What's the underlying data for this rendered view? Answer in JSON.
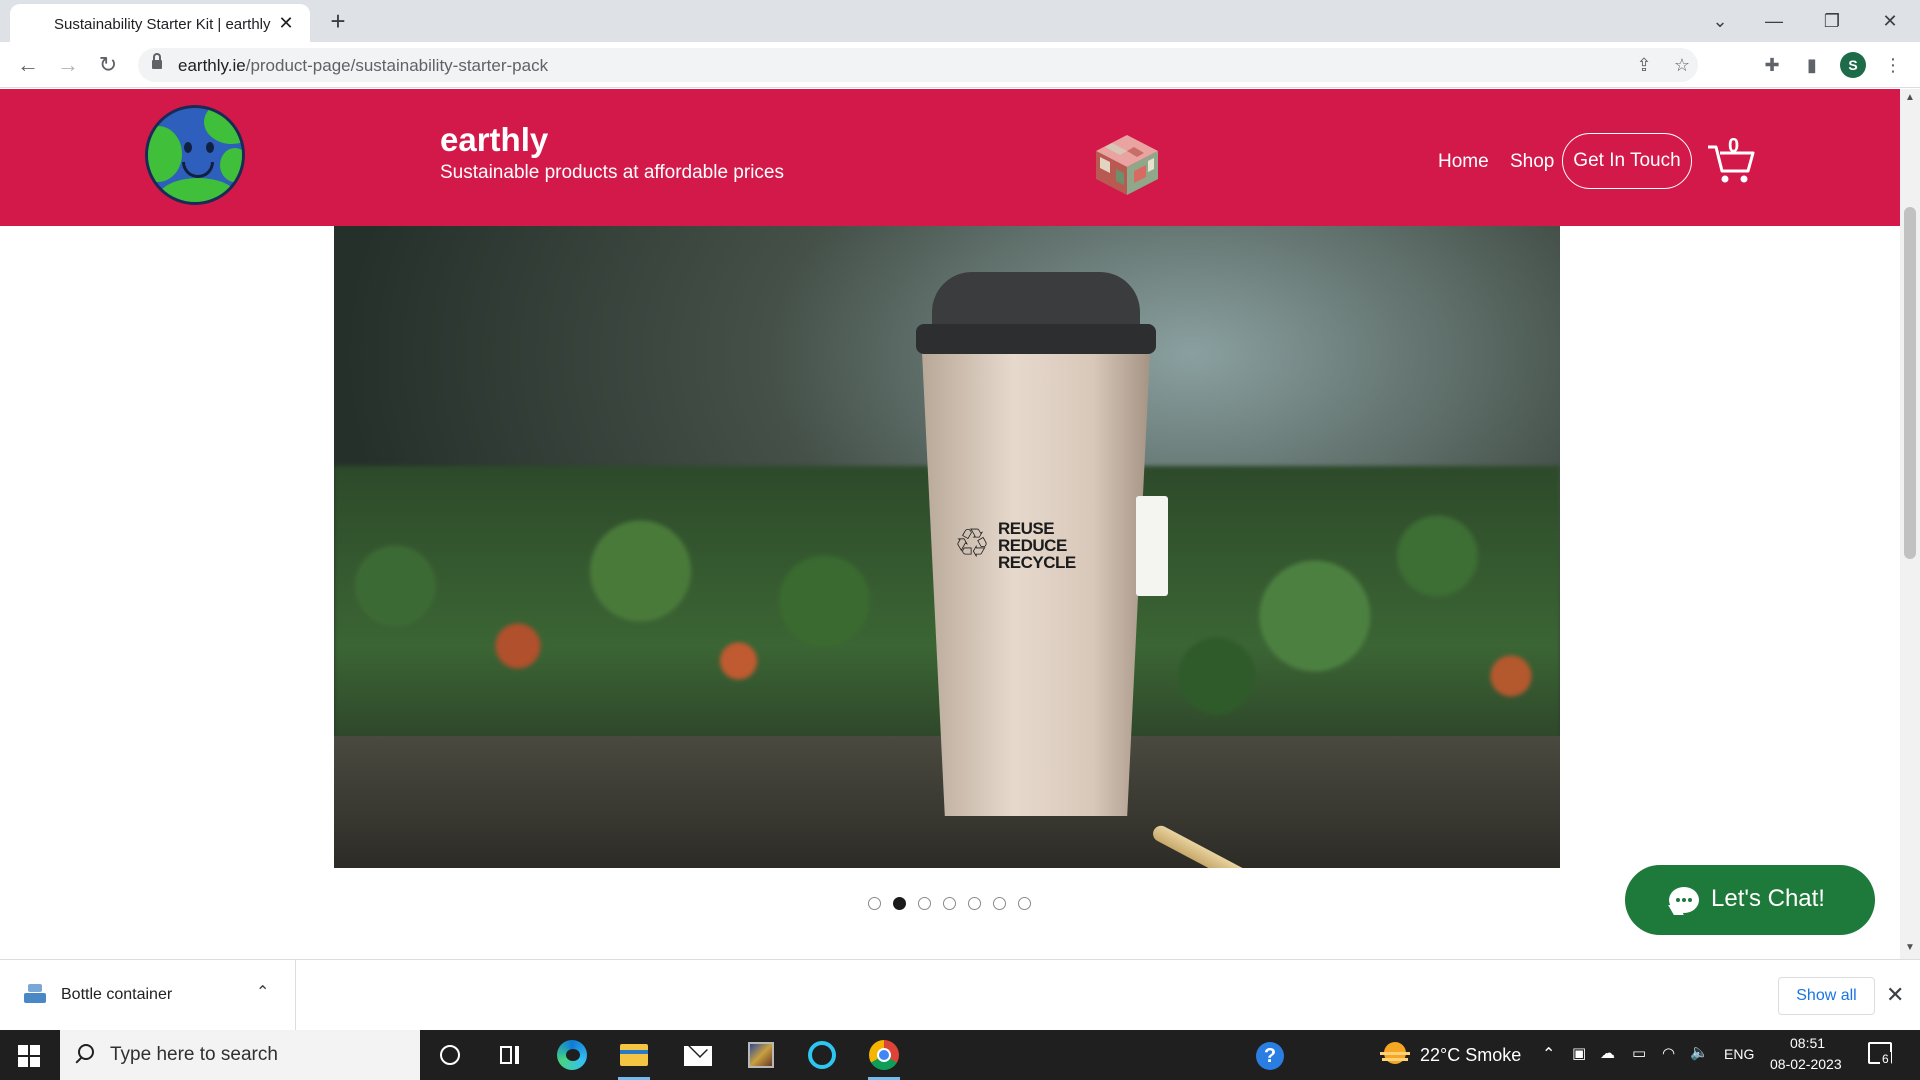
{
  "browser": {
    "tab_title": "Sustainability Starter Kit | earthly",
    "tab_close": "✕",
    "new_tab": "+",
    "url_host": "earthly.ie",
    "url_path": "/product-page/sustainability-starter-pack",
    "profile_initial": "S"
  },
  "header": {
    "brand": "earthly",
    "tagline": "Sustainable products at affordable prices",
    "nav": [
      "Home",
      "Shop"
    ],
    "contact_label": "Get In Touch",
    "cart_count": "0",
    "brand_color": "#d3194a"
  },
  "product_image": {
    "cup_text": [
      "REUSE",
      "REDUCE",
      "RECYCLE"
    ],
    "recycle_glyph": "♲"
  },
  "carousel": {
    "total": 7,
    "active_index": 1
  },
  "chat": {
    "label": "Let's Chat!",
    "color": "#1e7a3a"
  },
  "download_bar": {
    "file_name": "Bottle container",
    "show_all": "Show all",
    "close": "✕"
  },
  "taskbar": {
    "search_placeholder": "Type here to search",
    "weather": "22°C  Smoke",
    "language": "ENG",
    "time": "08:51",
    "date": "08-02-2023",
    "notification_count": "6"
  },
  "icons": {
    "back": "back-arrow-icon",
    "forward": "forward-arrow-icon",
    "reload": "reload-icon",
    "share": "share-icon",
    "bookmark": "star-icon",
    "extensions": "puzzle-icon",
    "sidepanel": "side-panel-icon",
    "menu": "kebab-menu-icon"
  }
}
